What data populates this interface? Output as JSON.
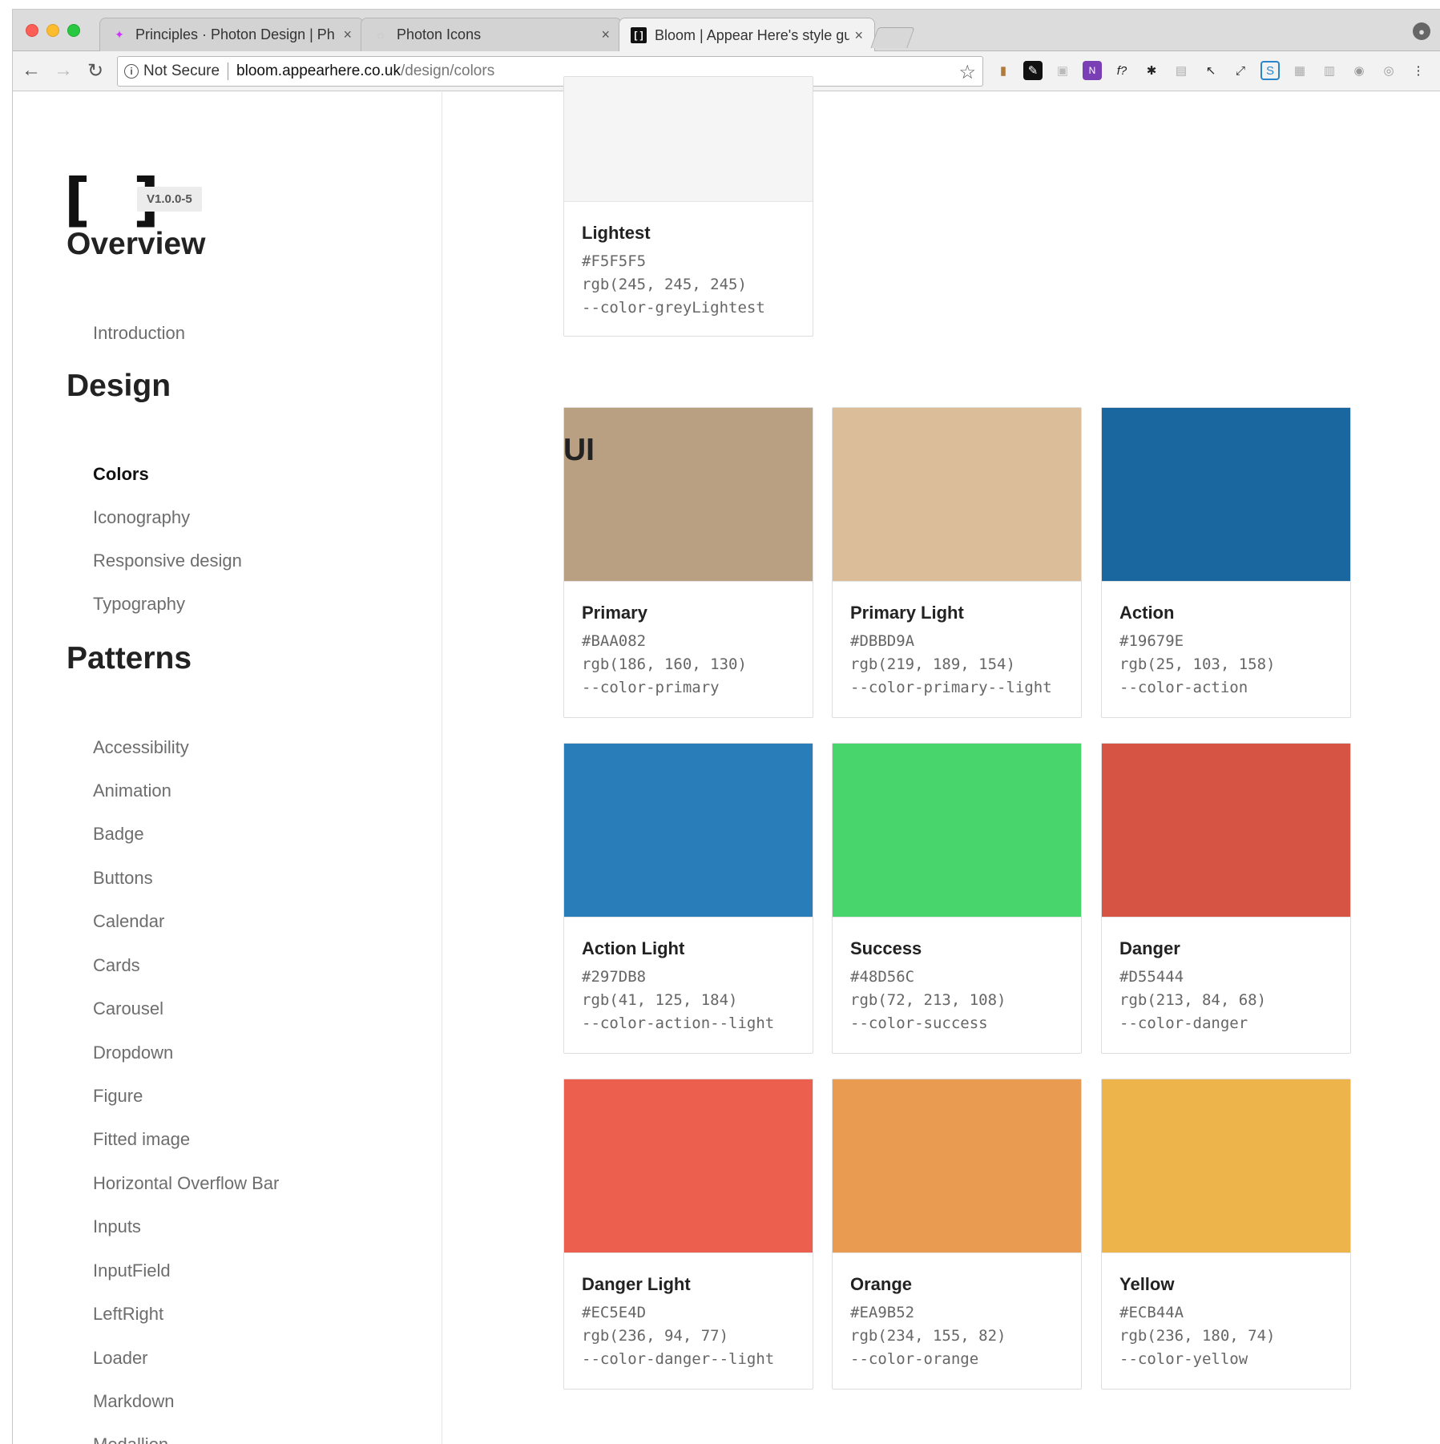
{
  "browser": {
    "tabs": [
      {
        "title": "Principles · Photon Design | Ph",
        "favicon": "photon-logo-icon"
      },
      {
        "title": "Photon Icons",
        "favicon": "loading-icon"
      },
      {
        "title": "Bloom | Appear Here's style gu",
        "favicon": "bloom-logo-icon"
      }
    ],
    "close_glyph": "×",
    "security": "Not Secure",
    "url_host": "bloom.appearhere.co.uk",
    "url_path": "/design/colors"
  },
  "sidebar": {
    "logo": "[ ]",
    "version": "V1.0.0-5",
    "sections": [
      {
        "title": "Overview",
        "items": [
          "Introduction"
        ]
      },
      {
        "title": "Design",
        "items": [
          "Colors",
          "Iconography",
          "Responsive design",
          "Typography"
        ],
        "active": "Colors"
      },
      {
        "title": "Patterns",
        "items": [
          "Accessibility",
          "Animation",
          "Badge",
          "Buttons",
          "Calendar",
          "Cards",
          "Carousel",
          "Dropdown",
          "Figure",
          "Fitted image",
          "Horizontal Overflow Bar",
          "Inputs",
          "InputField",
          "LeftRight",
          "Loader",
          "Markdown",
          "Medallion"
        ]
      }
    ]
  },
  "content": {
    "top_card": {
      "name": "Lightest",
      "hex": "#F5F5F5",
      "rgb": "rgb(245, 245, 245)",
      "var": "--color-greyLightest",
      "color": "#F5F5F5"
    },
    "ui_heading": "UI",
    "ui_cards": [
      {
        "name": "Primary",
        "hex": "#BAA082",
        "rgb": "rgb(186, 160, 130)",
        "var": "--color-primary",
        "color": "#BAA082"
      },
      {
        "name": "Primary Light",
        "hex": "#DBBD9A",
        "rgb": "rgb(219, 189, 154)",
        "var": "--color-primary--light",
        "color": "#DBBD9A"
      },
      {
        "name": "Action",
        "hex": "#19679E",
        "rgb": "rgb(25, 103, 158)",
        "var": "--color-action",
        "color": "#19679E"
      },
      {
        "name": "Action Light",
        "hex": "#297DB8",
        "rgb": "rgb(41, 125, 184)",
        "var": "--color-action--light",
        "color": "#297DB8"
      },
      {
        "name": "Success",
        "hex": "#48D56C",
        "rgb": "rgb(72, 213, 108)",
        "var": "--color-success",
        "color": "#48D56C"
      },
      {
        "name": "Danger",
        "hex": "#D55444",
        "rgb": "rgb(213, 84, 68)",
        "var": "--color-danger",
        "color": "#D55444"
      },
      {
        "name": "Danger Light",
        "hex": "#EC5E4D",
        "rgb": "rgb(236, 94, 77)",
        "var": "--color-danger--light",
        "color": "#EC5E4D"
      },
      {
        "name": "Orange",
        "hex": "#EA9B52",
        "rgb": "rgb(234, 155, 82)",
        "var": "--color-orange",
        "color": "#EA9B52"
      },
      {
        "name": "Yellow",
        "hex": "#ECB44A",
        "rgb": "rgb(236, 180, 74)",
        "var": "--color-yellow",
        "color": "#ECB44A"
      }
    ]
  }
}
